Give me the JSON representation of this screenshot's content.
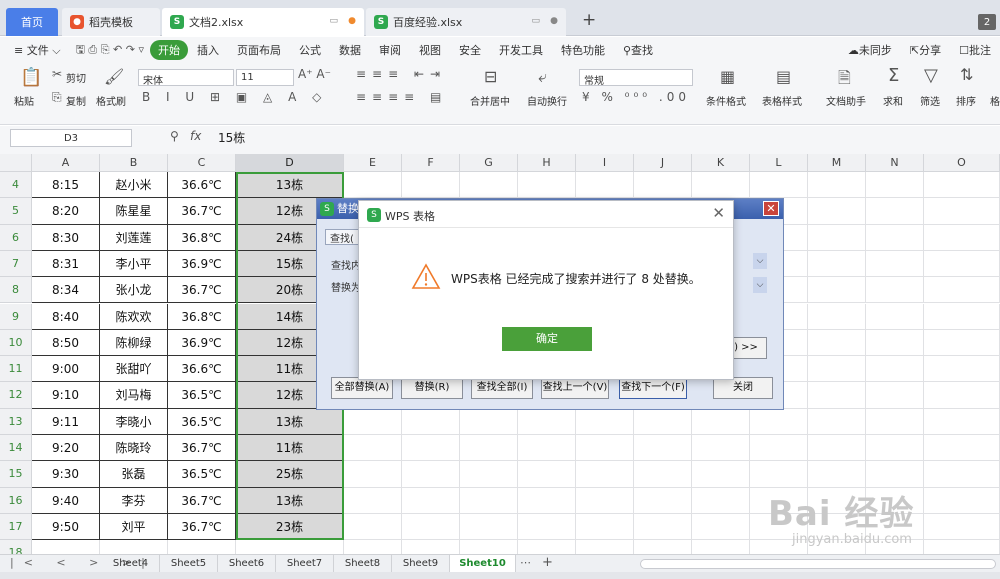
{
  "tabs": {
    "home": "首页",
    "wps": "稻壳模板",
    "doc": "文档2.xlsx",
    "doc2": "百度经验.xlsx",
    "plus": "+",
    "badge": "2"
  },
  "menu": [
    "文件",
    "开始",
    "插入",
    "页面布局",
    "公式",
    "数据",
    "审阅",
    "视图",
    "安全",
    "开发工具",
    "特色功能",
    "查找"
  ],
  "menu_right": {
    "sync": "未同步",
    "share": "分享",
    "annotate": "批注"
  },
  "ribbon": {
    "paste": "粘贴",
    "cut": "剪切",
    "copy": "复制",
    "format_painter": "格式刷",
    "font": "宋体",
    "size": "11",
    "number_format": "常规",
    "merge": "合并居中",
    "wrap": "自动换行",
    "cond_format": "条件格式",
    "table_style": "表格样式",
    "doc_helper": "文档助手",
    "sum": "求和",
    "filter": "筛选",
    "sort": "排序",
    "format": "格"
  },
  "formula": {
    "cell_ref": "D3",
    "fx": "fx",
    "value": "15栋"
  },
  "columns": [
    "A",
    "B",
    "C",
    "D",
    "E",
    "F",
    "G",
    "H",
    "I",
    "J",
    "K",
    "L",
    "M",
    "N",
    "O"
  ],
  "rows": [
    {
      "n": "4",
      "a": "8:15",
      "b": "赵小米",
      "c": "36.6℃",
      "d": "13栋"
    },
    {
      "n": "5",
      "a": "8:20",
      "b": "陈星星",
      "c": "36.7℃",
      "d": "12栋"
    },
    {
      "n": "6",
      "a": "8:30",
      "b": "刘莲莲",
      "c": "36.8℃",
      "d": "24栋"
    },
    {
      "n": "7",
      "a": "8:31",
      "b": "李小平",
      "c": "36.9℃",
      "d": "15栋"
    },
    {
      "n": "8",
      "a": "8:34",
      "b": "张小龙",
      "c": "36.7℃",
      "d": "20栋"
    },
    {
      "n": "9",
      "a": "8:40",
      "b": "陈欢欢",
      "c": "36.8℃",
      "d": "14栋"
    },
    {
      "n": "10",
      "a": "8:50",
      "b": "陈柳绿",
      "c": "36.9℃",
      "d": "12栋"
    },
    {
      "n": "11",
      "a": "9:00",
      "b": "张甜吖",
      "c": "36.6℃",
      "d": "11栋"
    },
    {
      "n": "12",
      "a": "9:10",
      "b": "刘马梅",
      "c": "36.5℃",
      "d": "12栋"
    },
    {
      "n": "13",
      "a": "9:11",
      "b": "李晓小",
      "c": "36.5℃",
      "d": "13栋"
    },
    {
      "n": "14",
      "a": "9:20",
      "b": "陈晓玲",
      "c": "36.7℃",
      "d": "11栋"
    },
    {
      "n": "15",
      "a": "9:30",
      "b": "张磊",
      "c": "36.5℃",
      "d": "25栋"
    },
    {
      "n": "16",
      "a": "9:40",
      "b": "李芬",
      "c": "36.7℃",
      "d": "13栋"
    },
    {
      "n": "17",
      "a": "9:50",
      "b": "刘平",
      "c": "36.7℃",
      "d": "23栋"
    },
    {
      "n": "18",
      "a": "",
      "b": "",
      "c": "",
      "d": ""
    }
  ],
  "sheets": [
    "Sheet4",
    "Sheet5",
    "Sheet6",
    "Sheet7",
    "Sheet8",
    "Sheet9",
    "Sheet10"
  ],
  "active_sheet": "Sheet10",
  "replace_dialog": {
    "title": "替换",
    "tab": "查找(",
    "find_label": "查找内",
    "replace_label": "替换为",
    "options": ") >>",
    "buttons": [
      "全部替换(A)",
      "替换(R)",
      "查找全部(I)",
      "查找上一个(V)",
      "查找下一个(F)",
      "关闭"
    ]
  },
  "message_dialog": {
    "title": "WPS 表格",
    "message": "WPS表格 已经完成了搜索并进行了 8 处替换。",
    "ok": "确定"
  },
  "watermark": {
    "brand": "Bai 经验",
    "url": "jingyan.baidu.com"
  }
}
